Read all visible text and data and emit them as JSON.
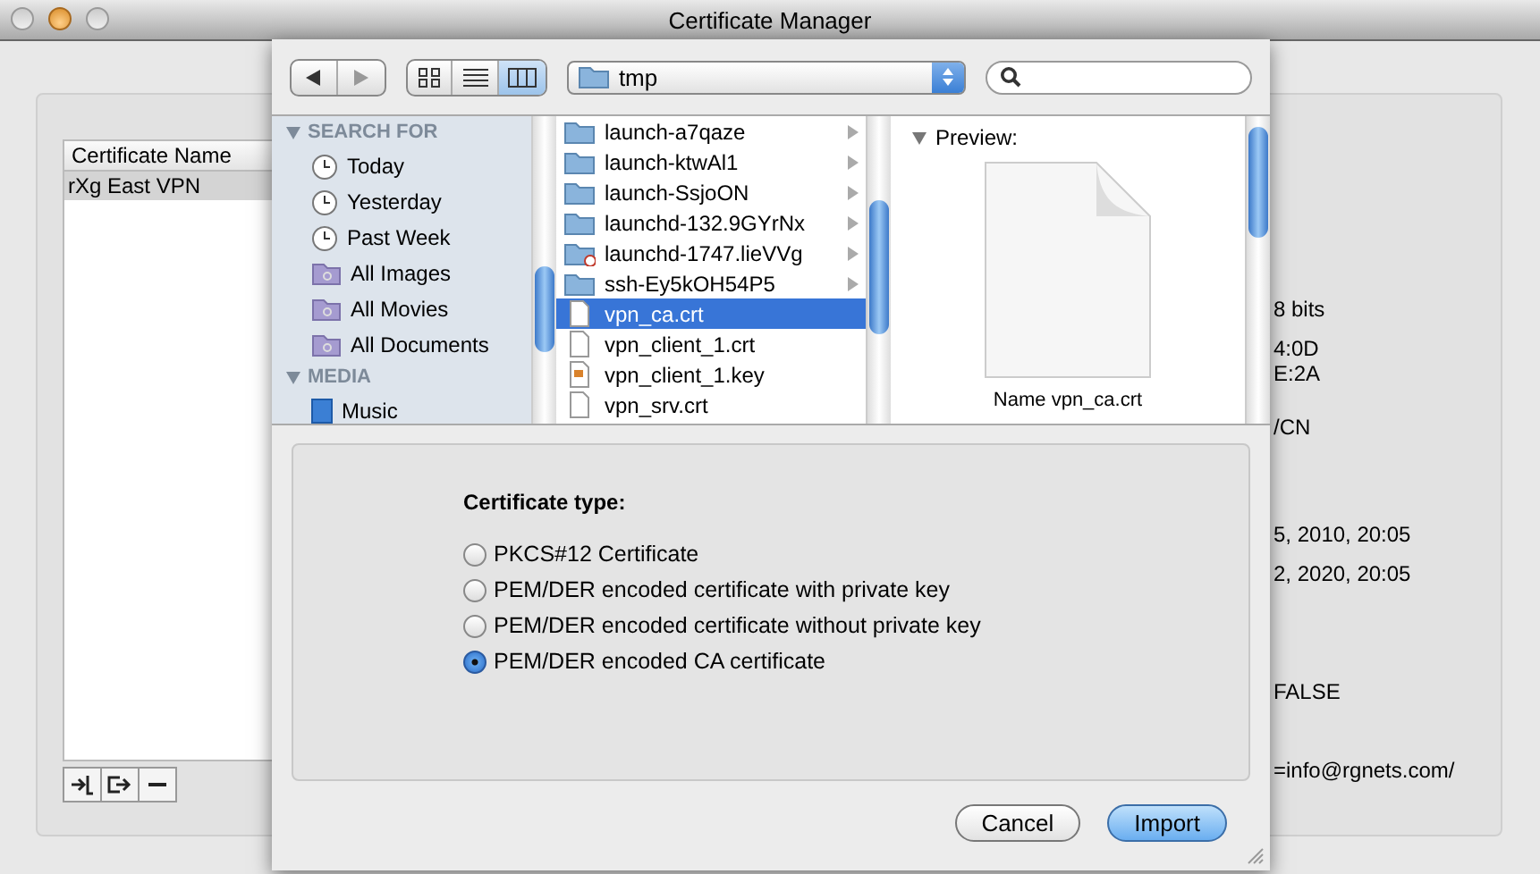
{
  "window": {
    "title": "Certificate Manager"
  },
  "certificate_table": {
    "columns": [
      "Certificate Name"
    ],
    "rows": [
      {
        "name": "rXg East VPN",
        "selected": true
      }
    ]
  },
  "details_fragments": [
    "8 bits",
    "4:0D",
    "E:2A",
    "/CN",
    "5, 2010, 20:05",
    "2, 2020, 20:05",
    "FALSE",
    "=info@rgnets.com/"
  ],
  "sheet": {
    "path": "tmp",
    "view_modes": [
      {
        "kind": "icon",
        "selected": false
      },
      {
        "kind": "list",
        "selected": false
      },
      {
        "kind": "column",
        "selected": true
      }
    ],
    "sidebar": [
      {
        "title": "SEARCH FOR",
        "items": [
          {
            "label": "Today",
            "kind": "clock"
          },
          {
            "label": "Yesterday",
            "kind": "clock"
          },
          {
            "label": "Past Week",
            "kind": "clock"
          },
          {
            "label": "All Images",
            "kind": "smart-folder"
          },
          {
            "label": "All Movies",
            "kind": "smart-folder"
          },
          {
            "label": "All Documents",
            "kind": "smart-folder"
          }
        ]
      },
      {
        "title": "MEDIA",
        "items": [
          {
            "label": "Music",
            "kind": "music"
          }
        ]
      }
    ],
    "files": [
      {
        "name": "launch-a7qaze",
        "kind": "folder",
        "selected": false
      },
      {
        "name": "launch-ktwAl1",
        "kind": "folder",
        "selected": false
      },
      {
        "name": "launch-SsjoON",
        "kind": "folder",
        "selected": false
      },
      {
        "name": "launchd-132.9GYrNx",
        "kind": "folder",
        "selected": false
      },
      {
        "name": "launchd-1747.lieVVg",
        "kind": "restricted-folder",
        "selected": false
      },
      {
        "name": "ssh-Ey5kOH54P5",
        "kind": "folder",
        "selected": false
      },
      {
        "name": "vpn_ca.crt",
        "kind": "file",
        "selected": true
      },
      {
        "name": "vpn_client_1.crt",
        "kind": "file",
        "selected": false
      },
      {
        "name": "vpn_client_1.key",
        "kind": "key-file",
        "selected": false
      },
      {
        "name": "vpn_srv.crt",
        "kind": "file",
        "selected": false
      }
    ],
    "preview": {
      "title": "Preview:",
      "name": "Name vpn_ca.crt"
    },
    "certificate_type": {
      "label": "Certificate type:",
      "options": [
        {
          "label": "PKCS#12 Certificate",
          "selected": false
        },
        {
          "label": "PEM/DER encoded certificate with private key",
          "selected": false
        },
        {
          "label": "PEM/DER encoded certificate without private key",
          "selected": false
        },
        {
          "label": "PEM/DER encoded CA certificate",
          "selected": true
        }
      ]
    },
    "buttons": [
      {
        "label": "Cancel",
        "kind": "secondary"
      },
      {
        "label": "Import",
        "kind": "default"
      }
    ]
  }
}
